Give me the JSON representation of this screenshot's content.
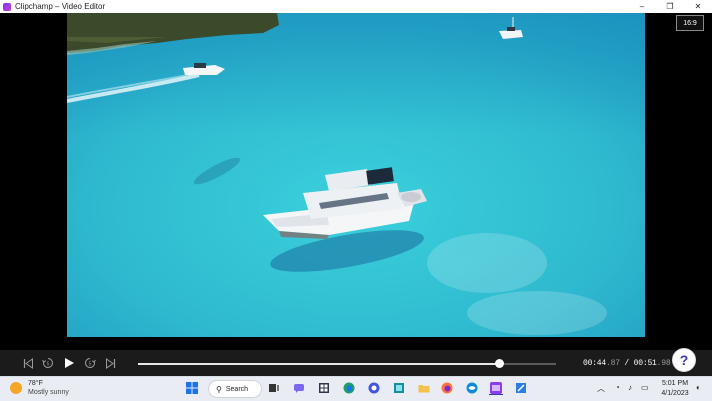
{
  "window": {
    "title": "Clipchamp – Video Editor",
    "controls": {
      "minimize": "–",
      "maximize": "❐",
      "close": "✕"
    }
  },
  "player": {
    "aspect_ratio": "16:9",
    "time_current_main": "00:44",
    "time_current_frac": ".87",
    "time_separator": " / ",
    "time_total_main": "00:51",
    "time_total_frac": ".98",
    "progress_fraction": 0.864,
    "help_label": "?"
  },
  "taskbar": {
    "weather_temp": "78°F",
    "weather_desc": "Mostly sunny",
    "search_label": "Search",
    "clock_time": "5:01 PM",
    "clock_date": "4/1/2023"
  },
  "colors": {
    "accent": "#3b36b7",
    "water": "#39c5d1",
    "titlebar": "#ffffff",
    "controls_bg": "#1b1b1b",
    "taskbar_bg": "#e9ecf3"
  }
}
